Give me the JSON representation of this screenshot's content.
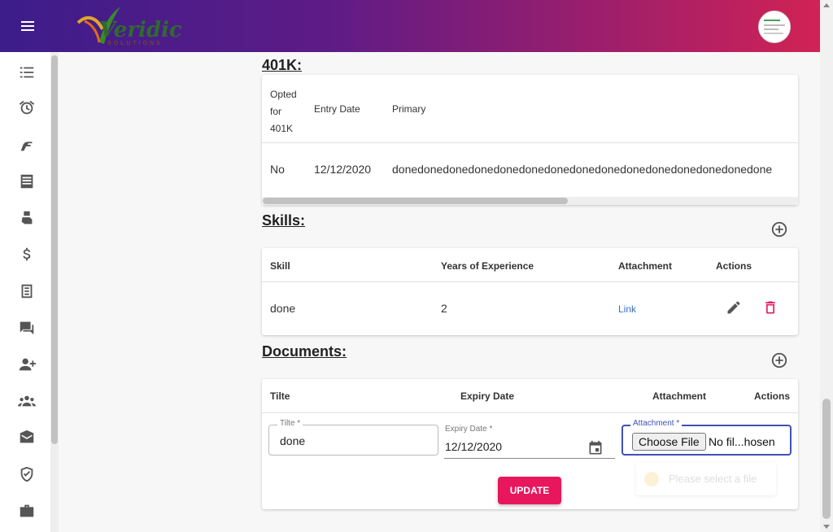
{
  "header": {
    "logo_text": "Veridic",
    "logo_sub": "SOLUTIONS"
  },
  "sidebar": {
    "icons": [
      "checklist-icon",
      "alarm-icon",
      "hand-icon",
      "notes-icon",
      "hand-money-icon",
      "dollar-icon",
      "document-icon",
      "chat-icon",
      "add-user-icon",
      "group-icon",
      "mail-icon",
      "shield-check-icon",
      "briefcase-icon"
    ]
  },
  "k401": {
    "title": "401K:",
    "headers": {
      "opted_line1": "Opted",
      "opted_line2": "for",
      "opted_line3": "401K",
      "entry_date": "Entry Date",
      "primary": "Primary"
    },
    "row": {
      "opted": "No",
      "entry_date": "12/12/2020",
      "primary": "donedonedonedonedonedonedonedonedonedonedonedonedonedonedone"
    }
  },
  "skills": {
    "title": "Skills:",
    "headers": {
      "skill": "Skill",
      "years": "Years of Experience",
      "attachment": "Attachment",
      "actions": "Actions"
    },
    "row": {
      "skill": "done",
      "years": "2",
      "attachment": "Link"
    }
  },
  "documents": {
    "title": "Documents:",
    "headers": {
      "title": "Tilte",
      "expiry": "Expiry Date",
      "attachment": "Attachment",
      "actions": "Actions"
    },
    "form": {
      "title_label": "Tilte *",
      "title_value": "done",
      "expiry_label": "Expiry Date *",
      "expiry_value": "12/12/2020",
      "attachment_label": "Attachment *",
      "choose_file": "Choose File",
      "file_status": "No fil...hosen"
    },
    "update_label": "UPDATE",
    "toast": "Please select a file"
  },
  "colors": {
    "accent": "#e8175d",
    "header_start": "#3c1d8a",
    "header_end": "#d12255",
    "link": "#3a6fbf",
    "delete": "#e8175d"
  }
}
